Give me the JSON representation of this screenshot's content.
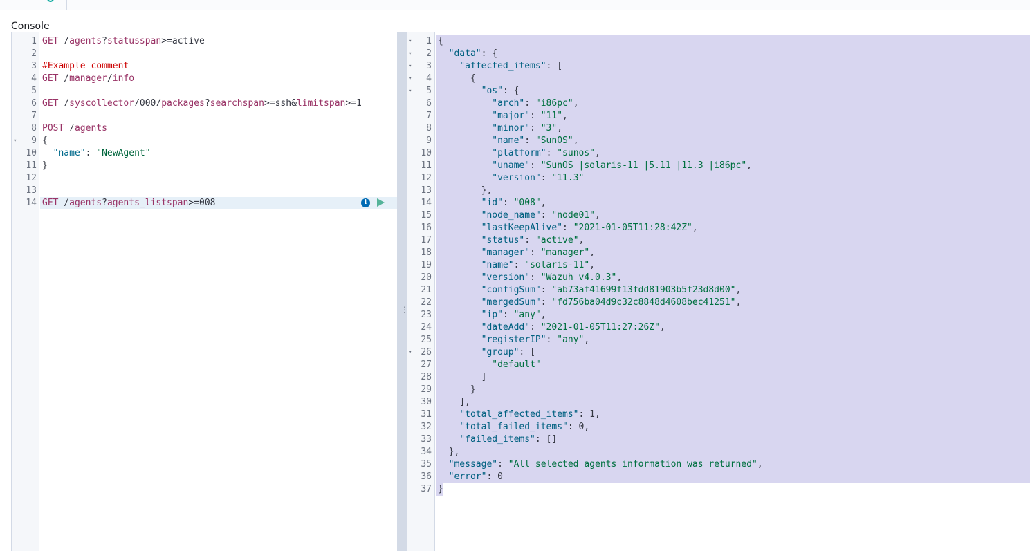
{
  "console": {
    "title": "Console"
  },
  "request_editor": {
    "lines": [
      {
        "n": "1",
        "text": "GET /agents?status=active",
        "fold": false
      },
      {
        "n": "2",
        "text": "",
        "fold": false
      },
      {
        "n": "3",
        "text": "#Example comment",
        "fold": false
      },
      {
        "n": "4",
        "text": "GET /manager/info",
        "fold": false
      },
      {
        "n": "5",
        "text": "",
        "fold": false
      },
      {
        "n": "6",
        "text": "GET /syscollector/000/packages?search=ssh&limit=1",
        "fold": false
      },
      {
        "n": "7",
        "text": "",
        "fold": false
      },
      {
        "n": "8",
        "text": "POST /agents",
        "fold": false
      },
      {
        "n": "9",
        "text": "{",
        "fold": true
      },
      {
        "n": "10",
        "text": "  \"name\": \"NewAgent\"",
        "fold": false
      },
      {
        "n": "11",
        "text": "}",
        "fold": false
      },
      {
        "n": "12",
        "text": "",
        "fold": false
      },
      {
        "n": "13",
        "text": "",
        "fold": false
      },
      {
        "n": "14",
        "text": "GET /agents?agents_list=008",
        "fold": false
      }
    ],
    "active_line": "14",
    "actions": {
      "info_icon": "info-icon",
      "run_icon": "play-icon",
      "info_glyph": "i"
    }
  },
  "response_viewer": {
    "lines": [
      {
        "n": "1",
        "text": "{",
        "fold": true
      },
      {
        "n": "2",
        "text": "  \"data\": {",
        "fold": true
      },
      {
        "n": "3",
        "text": "    \"affected_items\": [",
        "fold": true
      },
      {
        "n": "4",
        "text": "      {",
        "fold": true
      },
      {
        "n": "5",
        "text": "        \"os\": {",
        "fold": true
      },
      {
        "n": "6",
        "text": "          \"arch\": \"i86pc\",",
        "fold": false
      },
      {
        "n": "7",
        "text": "          \"major\": \"11\",",
        "fold": false
      },
      {
        "n": "8",
        "text": "          \"minor\": \"3\",",
        "fold": false
      },
      {
        "n": "9",
        "text": "          \"name\": \"SunOS\",",
        "fold": false
      },
      {
        "n": "10",
        "text": "          \"platform\": \"sunos\",",
        "fold": false
      },
      {
        "n": "11",
        "text": "          \"uname\": \"SunOS |solaris-11 |5.11 |11.3 |i86pc\",",
        "fold": false
      },
      {
        "n": "12",
        "text": "          \"version\": \"11.3\"",
        "fold": false
      },
      {
        "n": "13",
        "text": "        },",
        "fold": false
      },
      {
        "n": "14",
        "text": "        \"id\": \"008\",",
        "fold": false
      },
      {
        "n": "15",
        "text": "        \"node_name\": \"node01\",",
        "fold": false
      },
      {
        "n": "16",
        "text": "        \"lastKeepAlive\": \"2021-01-05T11:28:42Z\",",
        "fold": false
      },
      {
        "n": "17",
        "text": "        \"status\": \"active\",",
        "fold": false
      },
      {
        "n": "18",
        "text": "        \"manager\": \"manager\",",
        "fold": false
      },
      {
        "n": "19",
        "text": "        \"name\": \"solaris-11\",",
        "fold": false
      },
      {
        "n": "20",
        "text": "        \"version\": \"Wazuh v4.0.3\",",
        "fold": false
      },
      {
        "n": "21",
        "text": "        \"configSum\": \"ab73af41699f13fdd81903b5f23d8d00\",",
        "fold": false
      },
      {
        "n": "22",
        "text": "        \"mergedSum\": \"fd756ba04d9c32c8848d4608bec41251\",",
        "fold": false
      },
      {
        "n": "23",
        "text": "        \"ip\": \"any\",",
        "fold": false
      },
      {
        "n": "24",
        "text": "        \"dateAdd\": \"2021-01-05T11:27:26Z\",",
        "fold": false
      },
      {
        "n": "25",
        "text": "        \"registerIP\": \"any\",",
        "fold": false
      },
      {
        "n": "26",
        "text": "        \"group\": [",
        "fold": true
      },
      {
        "n": "27",
        "text": "          \"default\"",
        "fold": false
      },
      {
        "n": "28",
        "text": "        ]",
        "fold": false
      },
      {
        "n": "29",
        "text": "      }",
        "fold": false
      },
      {
        "n": "30",
        "text": "    ],",
        "fold": false
      },
      {
        "n": "31",
        "text": "    \"total_affected_items\": 1,",
        "fold": false
      },
      {
        "n": "32",
        "text": "    \"total_failed_items\": 0,",
        "fold": false
      },
      {
        "n": "33",
        "text": "    \"failed_items\": []",
        "fold": false
      },
      {
        "n": "34",
        "text": "  },",
        "fold": false
      },
      {
        "n": "35",
        "text": "  \"message\": \"All selected agents information was returned\",",
        "fold": false
      },
      {
        "n": "36",
        "text": "  \"error\": 0",
        "fold": false
      },
      {
        "n": "37",
        "text": "}",
        "fold": false
      }
    ]
  },
  "divider": {
    "grip_icon": "vertical-grip-icon",
    "grip_glyph": "⋮"
  },
  "colors": {
    "selection": "#d8d6f0",
    "active_line": "#e6f0f8",
    "method": "#993366",
    "comment": "#cc0000",
    "string": "#007040",
    "info_icon": "#006bb4",
    "play_icon": "#54b399"
  }
}
